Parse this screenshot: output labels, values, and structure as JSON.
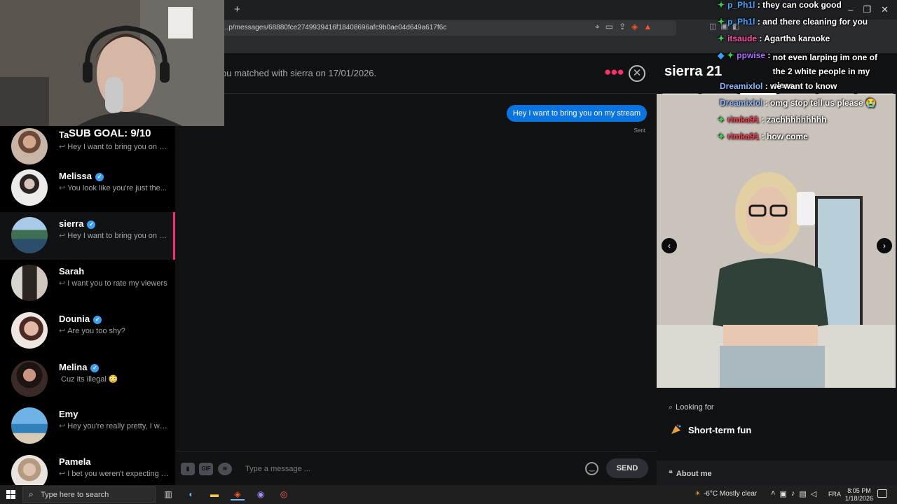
{
  "browser": {
    "url": "...p/messages/68880fce2749939416f18408696afc9b0ae04d649a617f6c",
    "new_tab": "+"
  },
  "conversations": [
    {
      "name": "Ta",
      "verified": false,
      "preview": "Hey I want to bring you on my stream"
    },
    {
      "name": "Melissa",
      "verified": true,
      "preview": "You look like you're just the..."
    },
    {
      "name": "sierra",
      "verified": true,
      "preview": "Hey I want to bring you on my stream",
      "active": true
    },
    {
      "name": "Sarah",
      "verified": false,
      "preview": "I want you to rate my viewers"
    },
    {
      "name": "Dounia",
      "verified": true,
      "preview": "Are you too shy?"
    },
    {
      "name": "Melina",
      "verified": true,
      "preview": "Cuz its illegal 😳"
    },
    {
      "name": "Emy",
      "verified": false,
      "preview": "Hey you're really pretty, I want..."
    },
    {
      "name": "Pamela",
      "verified": false,
      "preview": "I bet you weren't expecting me..."
    }
  ],
  "chat": {
    "match_text": "ou matched with sierra on 17/01/2026.",
    "messages": [
      {
        "text": "Hey I want to bring you on my stream",
        "status": "Sent"
      }
    ],
    "composer": {
      "placeholder": "Type a message ...",
      "gif_label": "GIF",
      "send_label": "SEND"
    }
  },
  "profile": {
    "name": "sierra 21",
    "photo_count": 6,
    "photo_index": 2,
    "looking_for_label": "Looking for",
    "looking_for_value": "Short-term fun",
    "about_label": "About me"
  },
  "overlay": {
    "sub_goal": "SUB GOAL: 9/10",
    "stream_chat": [
      {
        "user": "p_Ph1l",
        "color": "#3da3ff",
        "badges": [
          "✦"
        ],
        "message": "they can cook good"
      },
      {
        "user": "p_Ph1l",
        "color": "#3da3ff",
        "badges": [
          "✦"
        ],
        "message": "and there cleaning for you"
      },
      {
        "user": "itsaude",
        "color": "#ff4fa3",
        "badges": [
          "✦"
        ],
        "message": "Agartha karaoke"
      },
      {
        "user": "ppwise",
        "color": "#b06bff",
        "badges": [
          "◆",
          "✦"
        ],
        "message": "not even larping im one of the 2 white people in my class"
      },
      {
        "user": "Dreamixlol",
        "color": "#8ab4ff",
        "badges": [],
        "message": "we want to know"
      },
      {
        "user": "Dreamixlol",
        "color": "#8ab4ff",
        "badges": [],
        "message": "omg stop tell us please 😭"
      },
      {
        "user": "rimka91",
        "color": "#ff3b4f",
        "badges": [
          "✦"
        ],
        "message": "zachhhhhhhhh"
      },
      {
        "user": "rimka91",
        "color": "#ff3b4f",
        "badges": [
          "✦"
        ],
        "message": "how come"
      }
    ]
  },
  "taskbar": {
    "search_placeholder": "Type here to search",
    "weather": "-6°C  Mostly clear",
    "language": "FRA",
    "time": "8:05 PM",
    "date": "1/18/2026"
  },
  "colors": {
    "accent": "#fd297b",
    "bubble": "#0a74e0",
    "verified": "#3b9ef5"
  }
}
